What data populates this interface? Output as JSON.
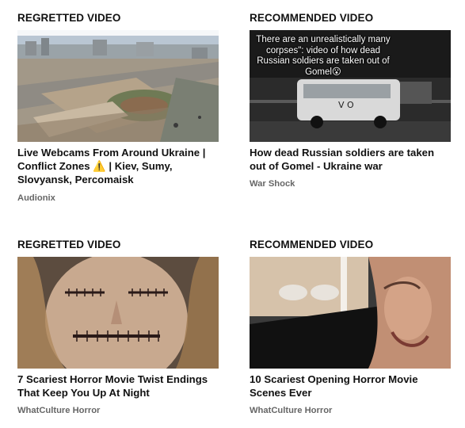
{
  "cards": [
    {
      "label": "REGRETTED VIDEO",
      "title": "Live Webcams From Around Ukraine | Conflict Zones ⚠️ | Kiev, Sumy, Slovyansk, Percomaisk",
      "title_pre": "Live Webcams From Around Ukraine | Conflict Zones ",
      "title_icon": "⚠️",
      "title_post": " | Kiev, Sumy, Slovyansk, Percomaisk",
      "channel": "Audionix",
      "thumbnail": "webcam-city-square-icon"
    },
    {
      "label": "RECOMMENDED VIDEO",
      "title": "How dead Russian soldiers are taken out of Gomel - Ukraine war",
      "channel": "War Shock",
      "thumbnail_caption": "There are an unrealistically many corpses\": video of how dead Russian soldiers are taken out of Gomel😮",
      "thumbnail": "bus-street-icon"
    },
    {
      "label": "REGRETTED VIDEO",
      "title": "7 Scariest Horror Movie Twist Endings That Keep You Up At Night",
      "channel": "WhatCulture Horror",
      "thumbnail": "stitched-face-icon"
    },
    {
      "label": "RECOMMENDED VIDEO",
      "title": "10 Scariest Opening Horror Movie Scenes Ever",
      "channel": "WhatCulture Horror",
      "thumbnail": "horror-faces-icon"
    }
  ],
  "colors": {
    "text": "#111111",
    "channel": "#666666",
    "warning": "#f2b705"
  }
}
